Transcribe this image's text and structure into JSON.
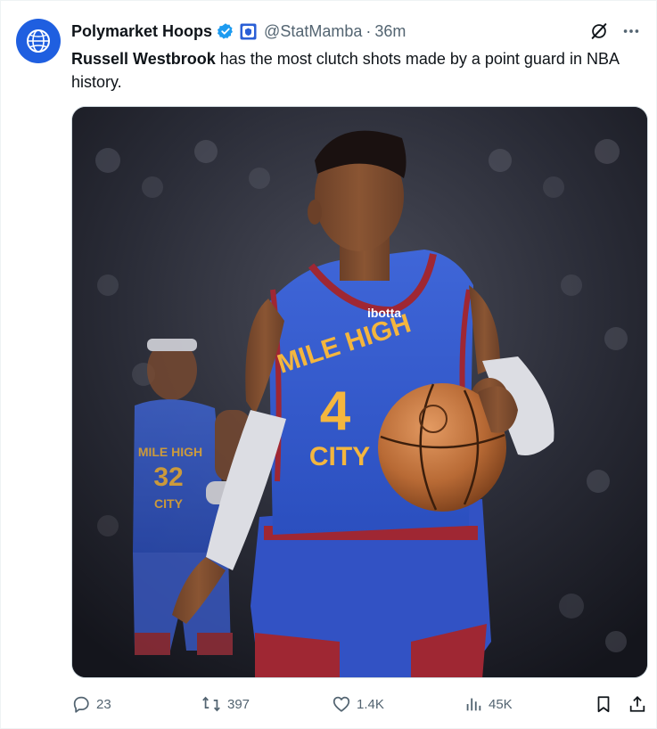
{
  "author": {
    "display_name": "Polymarket Hoops",
    "handle": "@StatMamba",
    "separator": "·",
    "time": "36m",
    "verified_icon": "verified-badge-icon",
    "affiliate_icon": "affiliate-badge-icon",
    "avatar_icon": "basketball-globe-icon",
    "accent": "#1d9bf0"
  },
  "tweet": {
    "highlight": "Russell Westbrook",
    "text_rest": " has the most clutch shots made by a point guard in NBA history."
  },
  "media": {
    "jersey": {
      "sponsor": "ibotta",
      "line1": "MILE HIGH",
      "number": "4",
      "line2": "CITY",
      "back_line1": "MILE HIGH",
      "back_number": "32",
      "back_line2": "CITY"
    }
  },
  "actions": {
    "replies": "23",
    "reposts": "397",
    "likes": "1.4K",
    "views": "45K"
  }
}
